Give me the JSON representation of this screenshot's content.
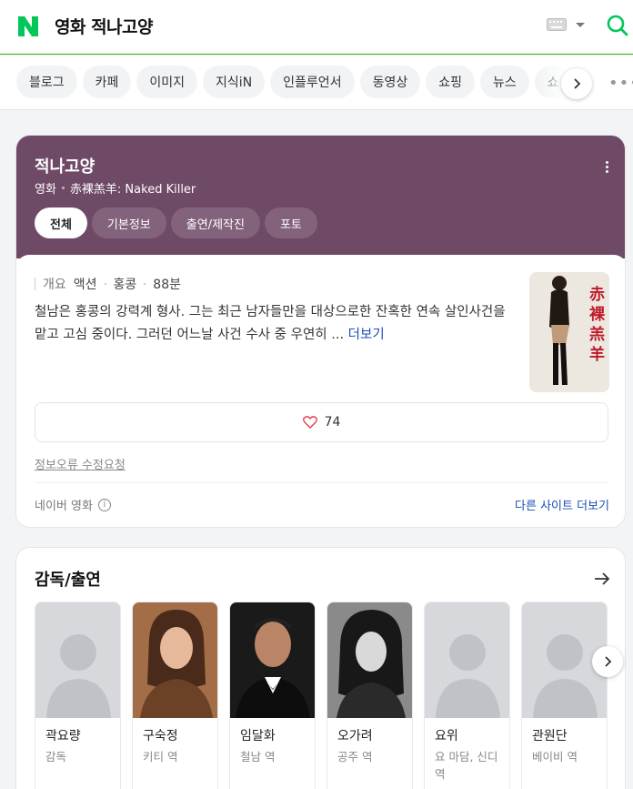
{
  "header": {
    "logo": "N",
    "query": "영화 적나고양"
  },
  "tabs": [
    "블로그",
    "카페",
    "이미지",
    "지식iN",
    "인플루언서",
    "동영상",
    "쇼핑",
    "뉴스",
    "쇼"
  ],
  "movie": {
    "title": "적나고양",
    "category": "영화",
    "original_title": "赤裸羔羊: Naked Killer",
    "tabs": [
      {
        "label": "전체",
        "active": true
      },
      {
        "label": "기본정보",
        "active": false
      },
      {
        "label": "출연/제작진",
        "active": false
      },
      {
        "label": "포토",
        "active": false
      }
    ],
    "meta": {
      "overview_label": "개요",
      "genre": "액션",
      "country": "홍콩",
      "runtime": "88분"
    },
    "synopsis": "철남은 홍콩의 강력계 형사. 그는 최근 남자들만을 대상으로한 잔혹한 연속 살인사건을 맡고 고심 중이다. 그러던 어느날 사건 수사 중 우연히 ...",
    "more_label": "더보기",
    "poster_text": "赤裸羔羊",
    "likes": "74",
    "report_label": "정보오류 수정요청",
    "source_label": "네이버 영화",
    "other_sites_label": "다른 사이트 더보기"
  },
  "cast": {
    "title": "감독/출연",
    "members": [
      {
        "name": "곽요량",
        "role": "감독",
        "photo": "placeholder"
      },
      {
        "name": "구숙정",
        "role": "키티 역",
        "photo": "portrait-warm"
      },
      {
        "name": "임달화",
        "role": "철남 역",
        "photo": "portrait-tux"
      },
      {
        "name": "오가려",
        "role": "공주 역",
        "photo": "portrait-bw"
      },
      {
        "name": "요위",
        "role": "요 마담, 신디 역",
        "photo": "placeholder"
      },
      {
        "name": "관원단",
        "role": "베이비 역",
        "photo": "placeholder"
      }
    ]
  },
  "colors": {
    "naver_green": "#03c75a",
    "movie_header": "#6f4a67",
    "link_blue": "#1a4fb5"
  }
}
